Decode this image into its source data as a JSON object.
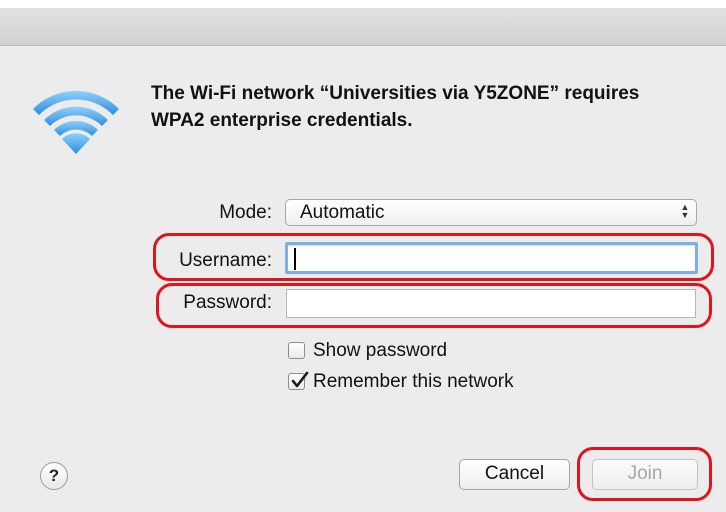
{
  "dialog": {
    "message": "The Wi-Fi network “Universities via Y5ZONE” requires WPA2 enterprise credentials."
  },
  "form": {
    "mode_label": "Mode:",
    "mode_value": "Automatic",
    "username_label": "Username:",
    "username_value": "",
    "password_label": "Password:",
    "password_value": ""
  },
  "options": {
    "show_password_label": "Show password",
    "show_password_checked": false,
    "remember_label": "Remember this network",
    "remember_checked": true
  },
  "buttons": {
    "help_label": "?",
    "cancel_label": "Cancel",
    "join_label": "Join",
    "join_enabled": false
  },
  "colors": {
    "wifi_blue": "#4aa6e8",
    "highlight_red": "#e0141c",
    "focus_ring": "#7eaee8"
  },
  "icons": {
    "wifi": "wifi-icon",
    "checkmark": "checkmark-icon",
    "select_arrows": "up-down-arrows-icon"
  }
}
